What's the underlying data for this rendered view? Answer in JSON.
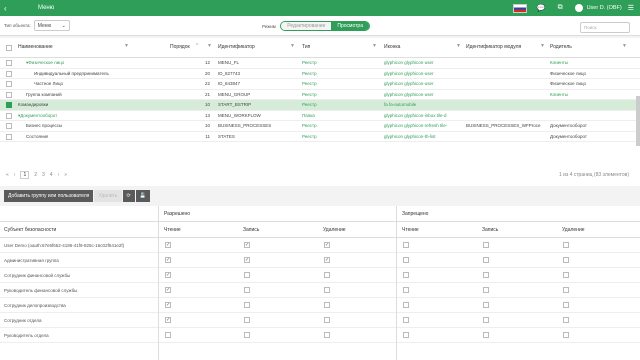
{
  "header": {
    "back": "‹",
    "title": "Меню",
    "user": "User D. (OBF)"
  },
  "toolbar": {
    "object_type_label": "Тип объекта:",
    "object_type": "Меню",
    "mode_label": "Режим",
    "mode_edit": "Редактирование",
    "mode_view": "Просмотра"
  },
  "grid": {
    "columns": [
      "Наименование",
      "Порядок",
      "Идентификатор",
      "Тип",
      "Иконка",
      "Идентификатор модуля",
      "Родитель"
    ],
    "search_placeholder": "Поиск",
    "rows": [
      {
        "name": "Физическое лицо",
        "order": "12",
        "id": "MENU_FL",
        "type": "Реестр",
        "icon": "glyphicon glyphicon-user",
        "module": "",
        "parent": "Клиенты",
        "green": true,
        "sel": false,
        "indent": 1,
        "expander": "▾"
      },
      {
        "name": "Индивидуальный предприниматель",
        "order": "20",
        "id": "ID_827743",
        "type": "Реестр",
        "icon": "glyphicon glyphicon-user",
        "module": "",
        "parent": "Физическое лицо",
        "green": false,
        "sel": false,
        "indent": 2,
        "expander": ""
      },
      {
        "name": "Частное Лицо",
        "order": "22",
        "id": "ID_843847",
        "type": "Реестр",
        "icon": "glyphicon glyphicon-user",
        "module": "",
        "parent": "Физическое лицо",
        "green": false,
        "sel": false,
        "indent": 2,
        "expander": ""
      },
      {
        "name": "Группа компаний",
        "order": "21",
        "id": "MENU_GROUP",
        "type": "Реестр",
        "icon": "glyphicon glyphicon-user",
        "module": "",
        "parent": "Клиенты",
        "green": false,
        "sel": false,
        "indent": 1,
        "expander": ""
      },
      {
        "name": "Командировки",
        "order": "10",
        "id": "START_BSTRIP",
        "type": "Реестр",
        "icon": "fa fa-automobile",
        "module": "",
        "parent": "",
        "green": false,
        "sel": true,
        "indent": 0,
        "expander": ""
      },
      {
        "name": "Документооборот",
        "order": "13",
        "id": "MENU_WORKFLOW",
        "type": "Папка",
        "icon": "glyphicon glyphicon-inbox tile-d",
        "module": "",
        "parent": "",
        "green": true,
        "sel": false,
        "indent": 0,
        "expander": "▾"
      },
      {
        "name": "Бизнес процессы",
        "order": "10",
        "id": "BUSINESS_PROCESSES",
        "type": "Реестр",
        "icon": "glyphicon glyphicon-refresh tile-",
        "module": "BUSINESS_PROCESSES_WFProce",
        "parent": "Документооборот",
        "green": false,
        "sel": false,
        "indent": 1,
        "expander": ""
      },
      {
        "name": "Состояния",
        "order": "11",
        "id": "STATES",
        "type": "Реестр",
        "icon": "glyphicon glyphicon-th-list",
        "module": "",
        "parent": "Документооборот",
        "green": false,
        "sel": false,
        "indent": 1,
        "expander": ""
      }
    ]
  },
  "pager": {
    "first": "«",
    "prev": "‹",
    "pages": [
      "1",
      "2",
      "3",
      "4"
    ],
    "next": "›",
    "last": "»",
    "info": "1 из 4 страниц (83 элементов)"
  },
  "actions": {
    "add": "Добавить группу или пользователя",
    "delete": "Удалить",
    "refresh": "⟳",
    "save": "💾"
  },
  "permissions": {
    "group_allowed": "Разрешено",
    "group_denied": "Запрещено",
    "subject_header": "Субъект безопасности",
    "cols": [
      "Чтение",
      "Запись",
      "Удаление",
      "Чтение",
      "Запись",
      "Удаление"
    ],
    "rows": [
      {
        "name": "User Demo (oauth:67e5f652-4196-41f9-825c-16c02f541e2f)",
        "v": [
          true,
          true,
          true,
          false,
          false,
          false
        ]
      },
      {
        "name": "Административная группа",
        "v": [
          true,
          true,
          true,
          false,
          false,
          false
        ]
      },
      {
        "name": "Сотрудник финансовой службы",
        "v": [
          true,
          false,
          false,
          false,
          false,
          false
        ]
      },
      {
        "name": "Руководитель финансовой службы",
        "v": [
          true,
          false,
          false,
          false,
          false,
          false
        ]
      },
      {
        "name": "Сотрудник делопроизводства",
        "v": [
          true,
          false,
          false,
          false,
          false,
          false
        ]
      },
      {
        "name": "Сотрудник отдела",
        "v": [
          true,
          false,
          false,
          false,
          false,
          false
        ]
      },
      {
        "name": "Руководитель отдела",
        "v": [
          false,
          false,
          false,
          false,
          false,
          false
        ]
      }
    ]
  }
}
